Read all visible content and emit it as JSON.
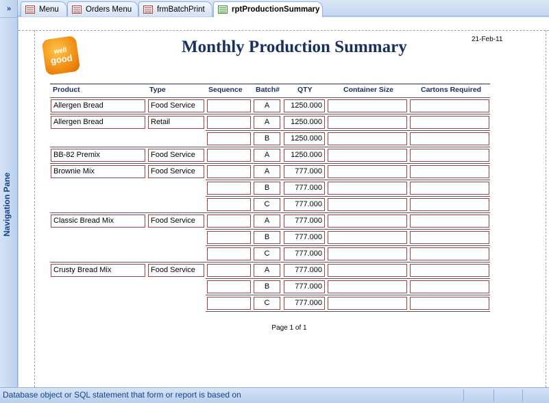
{
  "nav": {
    "toggle": "»",
    "label": "Navigation Pane"
  },
  "tabs": [
    {
      "label": "Menu",
      "icon": "form-icon"
    },
    {
      "label": "Orders Menu",
      "icon": "form-icon"
    },
    {
      "label": "frmBatchPrint",
      "icon": "form-icon"
    },
    {
      "label": "rptProductionSummary",
      "icon": "report-icon"
    }
  ],
  "report": {
    "logo_line1": "well",
    "logo_line2": "good",
    "title": "Monthly Production Summary",
    "date": "21-Feb-11",
    "columns": [
      "Product",
      "Type",
      "Sequence",
      "Batch#",
      "QTY",
      "Container Size",
      "Cartons Required"
    ],
    "rows": [
      {
        "product": "Allergen Bread",
        "type": "Food Service",
        "batch": "A",
        "qty": "1250.000"
      },
      {
        "product": "Allergen Bread",
        "type": "Retail",
        "batch": "A",
        "qty": "1250.000"
      },
      {
        "product": "",
        "type": "",
        "batch": "B",
        "qty": "1250.000"
      },
      {
        "product": "BB-82 Premix",
        "type": "Food Service",
        "batch": "A",
        "qty": "1250.000"
      },
      {
        "product": "Brownie Mix",
        "type": "Food Service",
        "batch": "A",
        "qty": "777.000"
      },
      {
        "product": "",
        "type": "",
        "batch": "B",
        "qty": "777.000"
      },
      {
        "product": "",
        "type": "",
        "batch": "C",
        "qty": "777.000"
      },
      {
        "product": "Classic Bread Mix",
        "type": "Food Service",
        "batch": "A",
        "qty": "777.000"
      },
      {
        "product": "",
        "type": "",
        "batch": "B",
        "qty": "777.000"
      },
      {
        "product": "",
        "type": "",
        "batch": "C",
        "qty": "777.000"
      },
      {
        "product": "Crusty Bread Mix",
        "type": "Food Service",
        "batch": "A",
        "qty": "777.000"
      },
      {
        "product": "",
        "type": "",
        "batch": "B",
        "qty": "777.000"
      },
      {
        "product": "",
        "type": "",
        "batch": "C",
        "qty": "777.000"
      }
    ],
    "page_label": "Page 1 of 1"
  },
  "status": {
    "text": "Database object or SQL statement that form or report is based on"
  },
  "colors": {
    "title": "#1a3160",
    "box_border": "#a04040",
    "chrome": "#bfd3ef"
  }
}
